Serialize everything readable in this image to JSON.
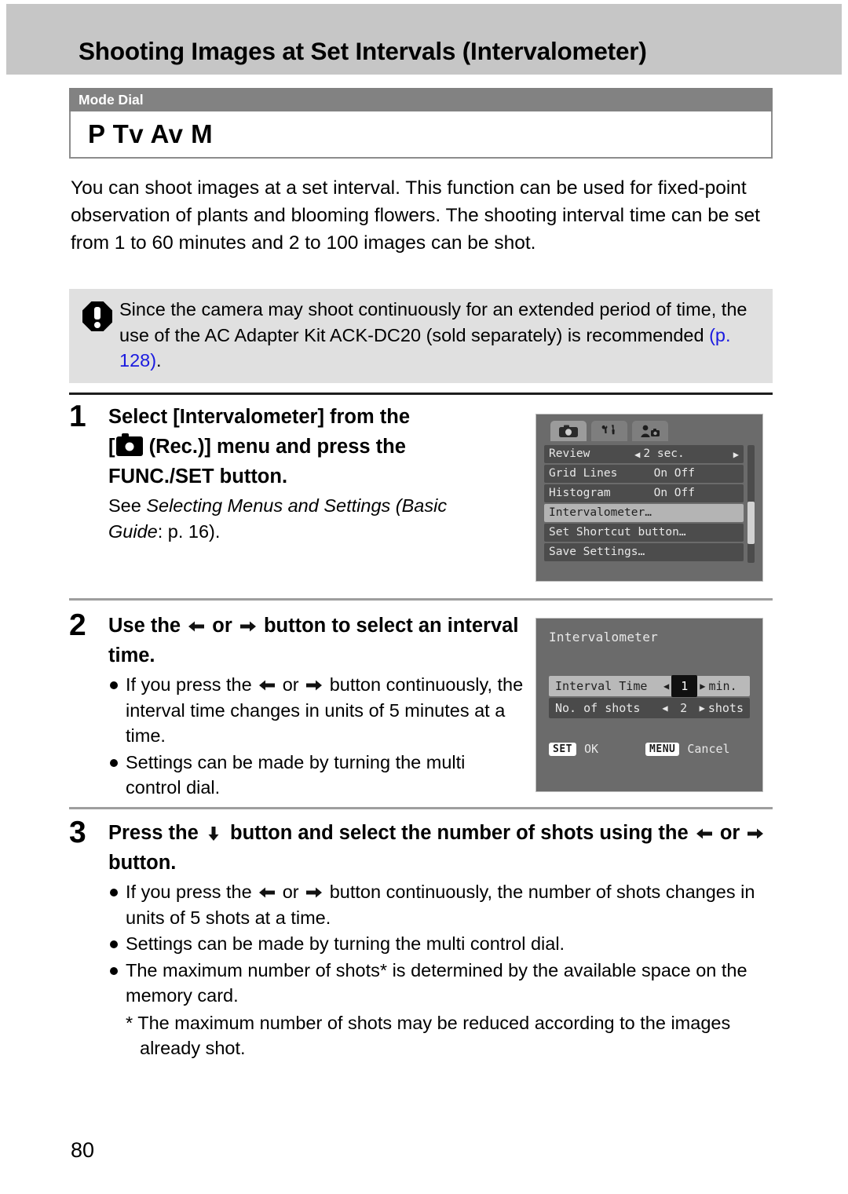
{
  "header": {
    "title": "Shooting Images at Set Intervals (Intervalometer)"
  },
  "mode_dial": {
    "label": "Mode Dial",
    "modes": "P Tv Av M"
  },
  "intro": "You can shoot images at a set interval. This function can be used for fixed-point observation of plants and blooming flowers. The shooting interval time can be set from 1 to 60 minutes and 2 to 100 images can be shot.",
  "note": {
    "icon": "exclamation-octagon-icon",
    "text_before": "Since the camera may shoot continuously for an extended period of time, the use of the AC Adapter Kit ACK-DC20 (sold separately) is recommended ",
    "link": "(p. 128)",
    "text_after": "."
  },
  "steps": [
    {
      "number": "1",
      "head_part1": "Select [Intervalometer] from the",
      "head_part2": "[",
      "head_icon": "rec-camera-icon",
      "head_part3": " (Rec.)] menu and press the",
      "head_part4": "FUNC./SET button.",
      "sub_pre": "See ",
      "sub_italic1": "Selecting Menus and Settings (Basic",
      "sub_italic2": "Guide",
      "sub_post": ": p. 16)."
    },
    {
      "number": "2",
      "head_pre": "Use the ",
      "head_mid": " or ",
      "head_post": " button to select an interval time.",
      "bullets": [
        {
          "pre": "If you press the ",
          "mid": " or ",
          "post": " button continuously, the interval time changes in units of 5 minutes at a time."
        },
        {
          "text": "Settings can be made by turning the multi control dial."
        }
      ]
    },
    {
      "number": "3",
      "head_pre": "Press the ",
      "head_mid": " button and select the number of shots using the ",
      "head_mid2": " or ",
      "head_post": " button.",
      "bullets": [
        {
          "pre": "If you press the ",
          "mid": " or ",
          "post": " button continuously, the number of shots changes in units of 5 shots at a time."
        },
        {
          "text": "Settings can be made by turning the multi control dial."
        },
        {
          "text": "The maximum number of shots* is determined by the available space on the memory card."
        }
      ],
      "footnote": "* The maximum number of shots may be reduced according to the images already shot."
    }
  ],
  "lcd_menu": {
    "tabs": [
      {
        "name": "rec-tab-icon",
        "active": true
      },
      {
        "name": "setup-tab-icon",
        "active": false
      },
      {
        "name": "my-camera-tab-icon",
        "active": false
      }
    ],
    "rows": [
      {
        "label": "Review",
        "value": "2 sec.",
        "arrows": "both",
        "selected": false
      },
      {
        "label": "Grid Lines",
        "value": "On Off",
        "arrows": "none",
        "selected": false
      },
      {
        "label": "Histogram",
        "value": "On Off",
        "arrows": "none",
        "selected": false
      },
      {
        "label": "Intervalometer…",
        "value": "",
        "arrows": "none",
        "selected": true
      },
      {
        "label": "Set Shortcut button…",
        "value": "",
        "arrows": "none",
        "selected": false
      },
      {
        "label": "Save Settings…",
        "value": "",
        "arrows": "none",
        "selected": false
      }
    ]
  },
  "lcd_interval": {
    "title": "Intervalometer",
    "rows": [
      {
        "label": "Interval Time",
        "value": "1",
        "unit": "min.",
        "selected": true
      },
      {
        "label": "No. of shots",
        "value": "2",
        "unit": "shots",
        "selected": false
      }
    ],
    "footer": {
      "set_key": "SET",
      "set_label": "OK",
      "menu_key": "MENU",
      "menu_label": "Cancel"
    }
  },
  "page_number": "80",
  "colors": {
    "header_band": "#c6c6c6",
    "mode_bar": "#828282",
    "note_bg": "#e0e0e0",
    "link": "#1a1ae0",
    "lcd_bg": "#6b6b6b"
  }
}
